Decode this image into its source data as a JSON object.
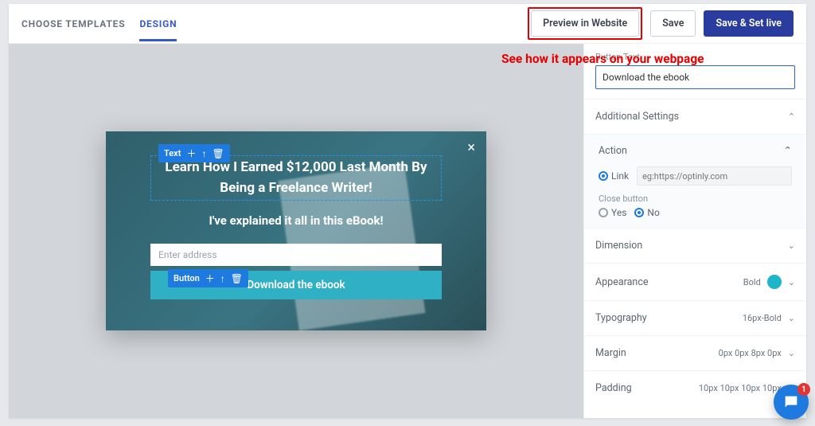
{
  "tabs": {
    "choose": "CHOOSE TEMPLATES",
    "design": "DESIGN"
  },
  "actions": {
    "preview": "Preview in Website",
    "save": "Save",
    "save_live": "Save & Set live"
  },
  "annotation": "See how it appears on your webpage",
  "popup": {
    "toolbar_text": "Text",
    "toolbar_button": "Button",
    "headline": "Learn How I Earned $12,000 Last Month By Being a Freelance Writer!",
    "subline": "I've explained it all in this eBook!",
    "email_placeholder": "Enter address",
    "cta": "Download the ebook"
  },
  "panel": {
    "button_text_label": "Button Text",
    "button_text_value": "Download the ebook",
    "additional": "Additional Settings",
    "action": {
      "title": "Action",
      "link_label": "Link",
      "link_placeholder": "eg:https://optinly.com",
      "close_label": "Close button",
      "yes": "Yes",
      "no": "No"
    },
    "rows": {
      "dimension": "Dimension",
      "appearance": "Appearance",
      "appearance_val": "Bold",
      "typography": "Typography",
      "typography_val": "16px-Bold",
      "margin": "Margin",
      "margin_val": "0px 0px 8px 0px",
      "padding": "Padding",
      "padding_val": "10px 10px 10px 10px"
    }
  },
  "chat": {
    "badge": "1"
  }
}
